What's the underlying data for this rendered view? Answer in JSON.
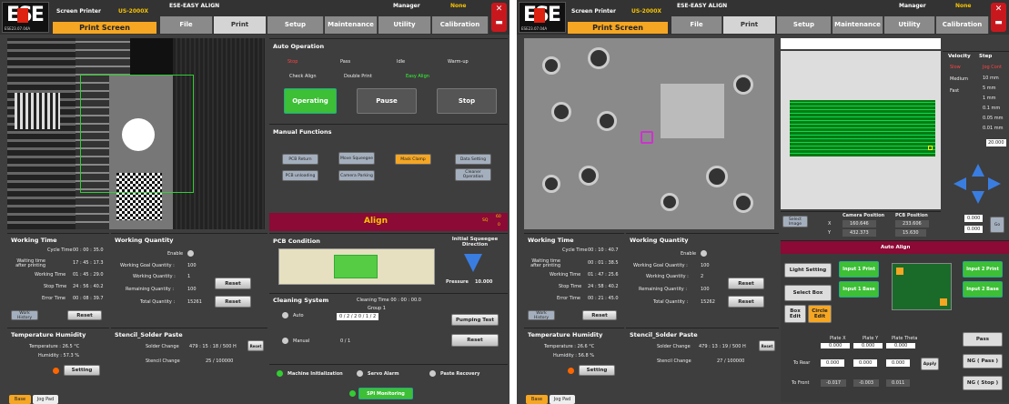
{
  "left": {
    "logo": "ESE",
    "logo_sub": "ESE23.07.04A",
    "app": "Screen Printer",
    "model": "US-2000X",
    "subtitle": "ESE-EASY ALIGN",
    "user": "Manager",
    "mode": "None",
    "screen": "Print Screen",
    "tabs": [
      "File",
      "Print",
      "Setup",
      "Maintenance",
      "Utility",
      "Calibration"
    ],
    "auto": {
      "title": "Auto Operation",
      "states": [
        "Stop",
        "Pass",
        "Idle",
        "Warm-up"
      ],
      "opts": [
        "Check Align",
        "Double Print",
        "Easy Align"
      ],
      "operating": "Operating",
      "pause": "Pause",
      "stop": "Stop"
    },
    "manual": {
      "title": "Manual Functions",
      "btns": [
        "PCB Return",
        "Move Squeegee",
        "Mask Clamp",
        "Data Setting",
        "PCB unloading",
        "Camera Parking",
        "Cleaner Operation"
      ]
    },
    "align": "Align",
    "align_sq": "SQ",
    "align_v1": "60",
    "align_v2": "0",
    "wt": {
      "title": "Working Time",
      "rows": [
        [
          "Cycle Time",
          "00 : 00 : 35.0"
        ],
        [
          "Waiting time after printing",
          "17 : 45 : 17.3"
        ],
        [
          "Working Time",
          "01 : 45 : 29.0"
        ],
        [
          "Stop Time",
          "24 : 56 : 40.2"
        ],
        [
          "Error Time",
          "00 : 08 : 39.7"
        ]
      ],
      "hist": "Work History",
      "reset": "Reset"
    },
    "wq": {
      "title": "Working Quantity",
      "enable": "Enable",
      "rows": [
        [
          "Working Goal Quantity :",
          "100"
        ],
        [
          "Working Quantity :",
          "1"
        ],
        [
          "Remaining Quantity :",
          "100"
        ],
        [
          "Total Quantity :",
          "15261"
        ]
      ],
      "reset1": "Reset",
      "reset2": "Reset"
    },
    "pcb": {
      "title": "PCB Condition",
      "squeegee": "Initial Squeegee Direction",
      "pressure_l": "Pressure",
      "pressure": "10.000"
    },
    "clean": {
      "title": "Cleaning System",
      "time": "Cleaning Time  00 : 00 : 00.0",
      "group": "Group 1",
      "auto": "Auto",
      "auto_v": "0  /  2   / 2     0  /  1  / 2",
      "manual": "Manual",
      "manual_v": "0  /  1",
      "pump": "Pumping Test",
      "reset": "Reset"
    },
    "th": {
      "title": "Temperature Humidity",
      "temp": "Temperature :  26.5 °C",
      "hum": "Humidity :  57.3 %",
      "setting": "Setting"
    },
    "st": {
      "title": "Stencil_Solder Paste",
      "solder": "Solder Change",
      "solder_v": "479 : 15 : 18  /  500  H",
      "reset": "Reset",
      "stencil": "Stencil Change",
      "stencil_v": "25  /  100000"
    },
    "status": [
      "Machine Initialization",
      "Servo Alarm",
      "Paste Recovery"
    ],
    "spi": "SPI Monitoring",
    "bottom": [
      "Base",
      "Jog Pad"
    ]
  },
  "right": {
    "logo": "ESE",
    "logo_sub": "ESE23.07.04A",
    "app": "Screen Printer",
    "model": "US-2000X",
    "subtitle": "ESE-EASY ALIGN",
    "user": "Manager",
    "mode": "None",
    "screen": "Print Screen",
    "tabs": [
      "File",
      "Print",
      "Setup",
      "Maintenance",
      "Utility",
      "Calibration"
    ],
    "vel": {
      "title": "Velocity",
      "step": "Step",
      "speeds": [
        "Slow",
        "Medium",
        "Fast"
      ],
      "steps": [
        "Jog Cont",
        "10 mm",
        "5 mm",
        "1 mm",
        "0.1 mm",
        "0.05 mm",
        "0.01 mm"
      ],
      "step_val": "20.000"
    },
    "cam": {
      "select": "Select Image",
      "cp": "Camera Position",
      "pp": "PCB Position",
      "x_l": "X",
      "y_l": "Y",
      "cx": "160.646",
      "cy": "432.373",
      "px": "233.606",
      "py": "15.630",
      "jv1": "0.000",
      "jv2": "0.000",
      "go": "Go"
    },
    "aa": {
      "title": "Auto Align",
      "light": "Light Setting",
      "in1p": "Input 1 Print",
      "in1b": "Input 1 Base",
      "in2p": "Input 2 Print",
      "in2b": "Input 2 Base",
      "sel": "Select Box",
      "box": "Box Edit",
      "circ": "Circle Edit",
      "cols": [
        "Plate X",
        "Plate Y",
        "Plate Theta"
      ],
      "r0": [
        "0.000",
        "0.000",
        "0.000"
      ],
      "r1_l": "To Rear",
      "r1": [
        "0.000",
        "0.000",
        "0.000"
      ],
      "r2_l": "To Front",
      "r2": [
        "-0.017",
        "-0.003",
        "0.011"
      ],
      "apply": "Apply",
      "pass": "Pass",
      "ngpass": "NG ( Pass )",
      "ngstop": "NG ( Stop )"
    },
    "wt": {
      "title": "Working Time",
      "rows": [
        [
          "Cycle Time",
          "00 : 10 : 40.7"
        ],
        [
          "Waiting time after printing",
          "00 : 01 : 38.5"
        ],
        [
          "Working Time",
          "01 : 47 : 25.6"
        ],
        [
          "Stop Time",
          "24 : 58 : 40.2"
        ],
        [
          "Error Time",
          "00 : 21 : 45.0"
        ]
      ],
      "hist": "Work History",
      "reset": "Reset"
    },
    "wq": {
      "title": "Working Quantity",
      "enable": "Enable",
      "rows": [
        [
          "Working Goal Quantity :",
          "100"
        ],
        [
          "Working Quantity :",
          "2"
        ],
        [
          "Remaining Quantity :",
          "100"
        ],
        [
          "Total Quantity :",
          "15262"
        ]
      ],
      "reset1": "Reset",
      "reset2": "Reset"
    },
    "th": {
      "title": "Temperature Humidity",
      "temp": "Temperature :  26.6 °C",
      "hum": "Humidity :  56.8 %",
      "setting": "Setting"
    },
    "st": {
      "title": "Stencil_Solder Paste",
      "solder": "Solder Change",
      "solder_v": "479 : 13 : 19  /  500  H",
      "reset": "Reset",
      "stencil": "Stencil Change",
      "stencil_v": "27  /  100000"
    },
    "bottom": [
      "Base",
      "Jog Pad"
    ]
  },
  "colors": {
    "accent": "#f5a623",
    "green": "#38d430",
    "red": "#d21",
    "align_bar": "#8b0a36",
    "grid_green": "#0a7a10",
    "blue": "#3a7de0"
  }
}
